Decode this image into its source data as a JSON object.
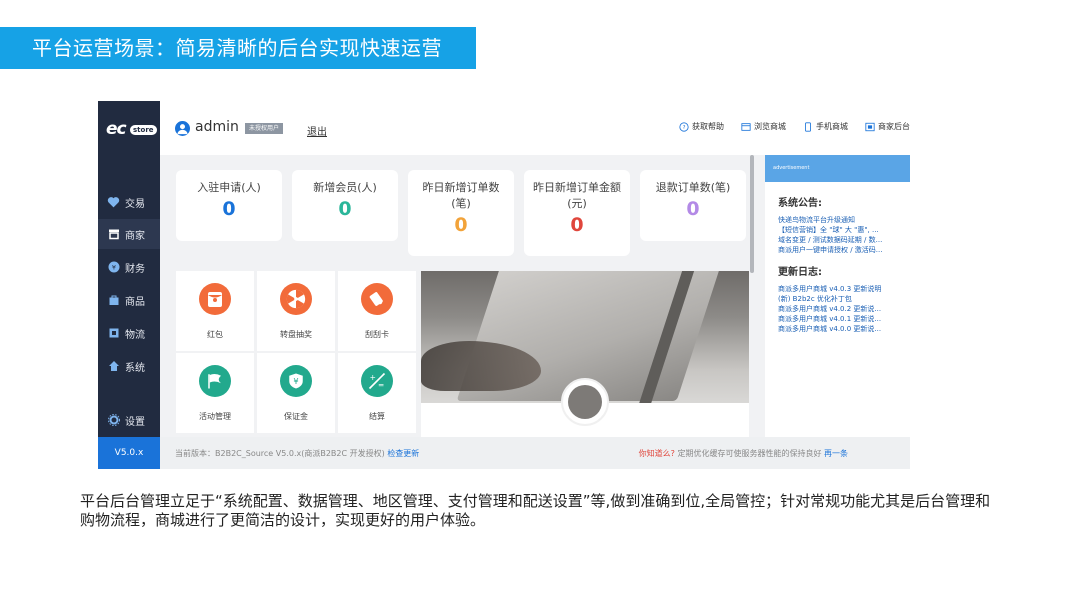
{
  "banner": {
    "title": "平台运营场景：简易清晰的后台实现快速运营"
  },
  "app": {
    "logo": {
      "ec": "ec",
      "store": "store"
    },
    "sidebar": {
      "items": [
        {
          "label": "交易",
          "icon": "heart-icon"
        },
        {
          "label": "商家",
          "icon": "store-icon"
        },
        {
          "label": "财务",
          "icon": "coin-icon"
        },
        {
          "label": "商品",
          "icon": "bag-icon"
        },
        {
          "label": "物流",
          "icon": "box-icon"
        },
        {
          "label": "系统",
          "icon": "home-icon"
        },
        {
          "label": "设置",
          "icon": "gear-icon"
        }
      ],
      "active": "商家",
      "version": "V5.0.x"
    },
    "topbar": {
      "username": "admin",
      "badge": "未授权用户",
      "logout": "退出",
      "links": [
        {
          "label": "获取帮助",
          "icon": "help-icon"
        },
        {
          "label": "浏览商城",
          "icon": "browser-icon"
        },
        {
          "label": "手机商城",
          "icon": "mobile-icon"
        },
        {
          "label": "商家后台",
          "icon": "merchant-icon"
        }
      ]
    },
    "stats": [
      {
        "label": "入驻申请(人)",
        "value": "0",
        "color": "#1a73d9"
      },
      {
        "label": "新增会员(人)",
        "value": "0",
        "color": "#2bb69a"
      },
      {
        "label": "昨日新增订单数\n(笔)",
        "value": "0",
        "color": "#f2a33a"
      },
      {
        "label": "昨日新增订单金额\n(元)",
        "value": "0",
        "color": "#e0463c"
      },
      {
        "label": "退款订单数(笔)",
        "value": "0",
        "color": "#b38ae6"
      }
    ],
    "tiles": [
      {
        "label": "红包",
        "icon": "red-packet-icon",
        "color": "#f26b3a"
      },
      {
        "label": "转盘抽奖",
        "icon": "wheel-icon",
        "color": "#f26b3a"
      },
      {
        "label": "刮刮卡",
        "icon": "scratch-card-icon",
        "color": "#f26b3a"
      },
      {
        "label": "活动管理",
        "icon": "flag-icon",
        "color": "#22a98d"
      },
      {
        "label": "保证金",
        "icon": "shield-icon",
        "color": "#22a98d"
      },
      {
        "label": "结算",
        "icon": "calculator-icon",
        "color": "#22a98d"
      }
    ],
    "right_panel": {
      "ad": "advertisement",
      "notice_title": "系统公告:",
      "notices": [
        "快递鸟物流平台升级通知",
        "【短信营销】全 \"球\" 大 \"惠\", ...",
        "域名变更 / 测试数据码延期 / 数...",
        "商派用户一键申请授权 / 激活码..."
      ],
      "log_title": "更新日志:",
      "logs": [
        "商派多用户商城 v4.0.3 更新说明",
        "(新) B2b2c 优化补丁包",
        "商派多用户商城 v4.0.2 更新说...",
        "商派多用户商城 v4.0.1 更新说...",
        "商派多用户商城 v4.0.0 更新说..."
      ]
    },
    "statusbar": {
      "left_text": "当前版本：B2B2C_Source V5.0.x(商派B2B2C 开发授权)",
      "left_link": "检查更新",
      "right_red": "你知道么?",
      "right_text": "定期优化缓存可使服务器性能的保持良好",
      "right_link": "再一条"
    }
  },
  "description": "平台后台管理立足于“系统配置、数据管理、地区管理、支付管理和配送设置”等,做到准确到位,全局管控；针对常规功能尤其是后台管理和购物流程，商城进行了更简洁的设计，实现更好的用户体验。"
}
